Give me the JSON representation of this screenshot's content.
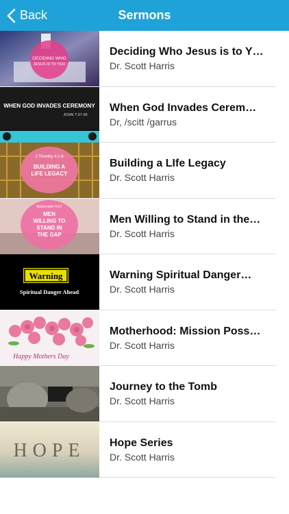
{
  "nav": {
    "back_label": "Back",
    "title": "Sermons"
  },
  "sermons": [
    {
      "title": "Deciding Who Jesus is to Y…",
      "author": "Dr. Scott Harris",
      "thumb_text": [
        "DECIDING WHO",
        "JESUS IS TO YOU"
      ]
    },
    {
      "title": "When God Invades Cerem…",
      "author": "Dr, /scitt /garrus",
      "thumb_text": [
        "WHEN GOD INVADES CEREMONY",
        "JOHN 7:37-39"
      ]
    },
    {
      "title": "Building a LIfe Legacy",
      "author": "Dr. Scott Harris",
      "thumb_text": [
        "2 Timothy 4:1-8",
        "BUILDING A",
        "LIFE LEGACY"
      ]
    },
    {
      "title": "Men Willing to Stand in the…",
      "author": "Dr. Scott Harris",
      "thumb_text": [
        "Nehemiah 4:07",
        "MEN",
        "WILLING TO",
        "STAND IN",
        "THE GAP"
      ]
    },
    {
      "title": "Warning Spiritual Danger…",
      "author": "Dr. Scott Harris",
      "thumb_text": [
        "Warning",
        "Spiritual Danger Ahead"
      ]
    },
    {
      "title": "Motherhood: Mission Poss…",
      "author": "Dr. Scott Harris",
      "thumb_text": [
        "Happy Mothers Day"
      ]
    },
    {
      "title": "Journey to the Tomb",
      "author": "Dr. Scott Harris",
      "thumb_text": []
    },
    {
      "title": "Hope Series",
      "author": "Dr. Scott Harris",
      "thumb_text": [
        "HOPE"
      ]
    }
  ]
}
